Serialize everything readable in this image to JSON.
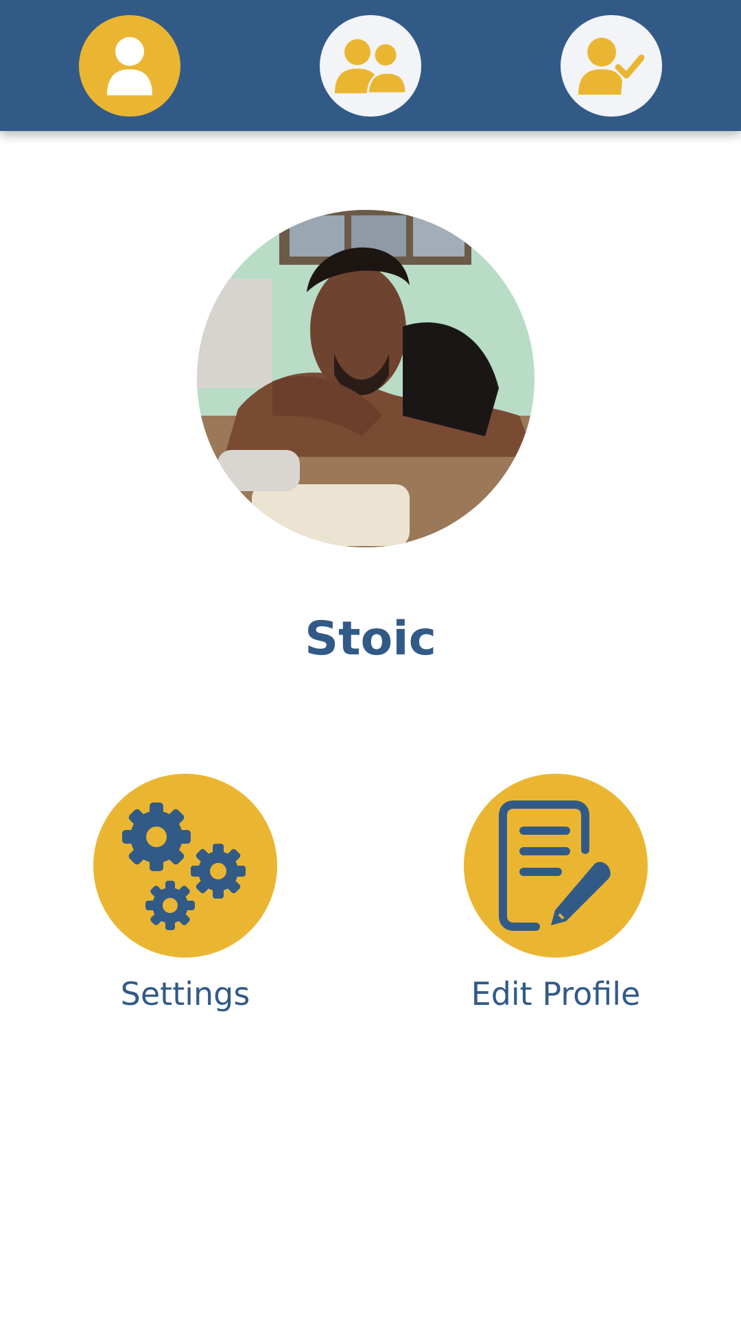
{
  "nav": {
    "items": [
      {
        "icon": "user-icon",
        "state": "active"
      },
      {
        "icon": "users-group-icon",
        "state": "inactive"
      },
      {
        "icon": "user-check-icon",
        "state": "inactive"
      }
    ]
  },
  "profile": {
    "name": "Stoic"
  },
  "actions": {
    "settings_label": "Settings",
    "settings_icon": "gears-icon",
    "edit_label": "Edit Profile",
    "edit_icon": "edit-document-icon"
  },
  "colors": {
    "primary": "#325a87",
    "accent": "#eab632",
    "inactive_bg": "#f3f4f8",
    "background": "#ffffff"
  }
}
